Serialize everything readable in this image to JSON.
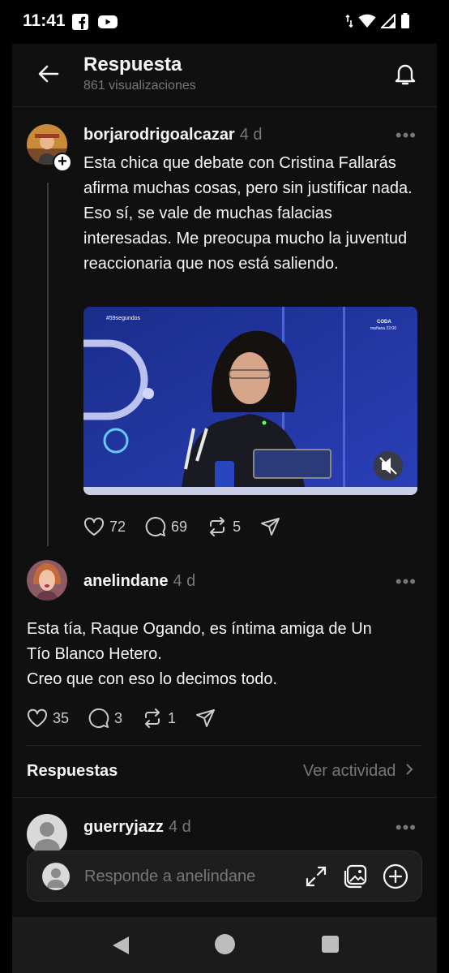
{
  "status": {
    "time": "11:41"
  },
  "header": {
    "title": "Respuesta",
    "views": "861 visualizaciones"
  },
  "posts": [
    {
      "username": "borjarodrigoalcazar",
      "time": "4 d",
      "text": "Esta chica que debate con Cristina Fallarás afirma muchas cosas, pero sin justificar nada. Eso sí, se vale de muchas falacias interesadas. Me preocupa mucho la juventud reaccionaria que nos está saliendo.",
      "media": {
        "tag": "#59segundos",
        "channel": "CODA",
        "schedule": "mañana 22:00"
      },
      "likes": "72",
      "comments": "69",
      "reposts": "5"
    },
    {
      "username": "anelindane",
      "time": "4 d",
      "text_lines": [
        "Esta tía, Raque Ogando, es íntima amiga de Un",
        "Tío Blanco Hetero.",
        "Creo que con eso lo decimos todo."
      ],
      "likes": "35",
      "comments": "3",
      "reposts": "1"
    }
  ],
  "replies_section": {
    "label": "Respuestas",
    "activity_link": "Ver actividad"
  },
  "next_reply": {
    "username": "guerryjazz",
    "time": "4 d"
  },
  "composer": {
    "placeholder": "Responde a anelindane"
  },
  "more": "•••"
}
